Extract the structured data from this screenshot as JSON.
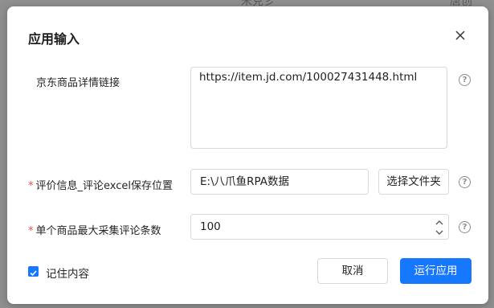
{
  "background": {
    "text_left": "米克彡",
    "text_right": "唐创"
  },
  "dialog": {
    "title": "应用输入",
    "close_icon": "close-icon"
  },
  "fields": {
    "url": {
      "label": "京东商品详情链接",
      "value": "https://item.jd.com/100027431448.html",
      "required": false
    },
    "save_path": {
      "label": "评价信息_评论excel保存位置",
      "value": "E:\\八爪鱼RPA数据",
      "button": "选择文件夹",
      "required": true
    },
    "max_comments": {
      "label": "单个商品最大采集评论条数",
      "value": "100",
      "required": true
    }
  },
  "help_icon_char": "?",
  "required_mark": "*",
  "footer": {
    "remember_label": "记住内容",
    "remember_checked": true,
    "cancel_label": "取消",
    "run_label": "运行应用"
  },
  "colors": {
    "primary": "#1677ff",
    "required": "#e5484d"
  }
}
